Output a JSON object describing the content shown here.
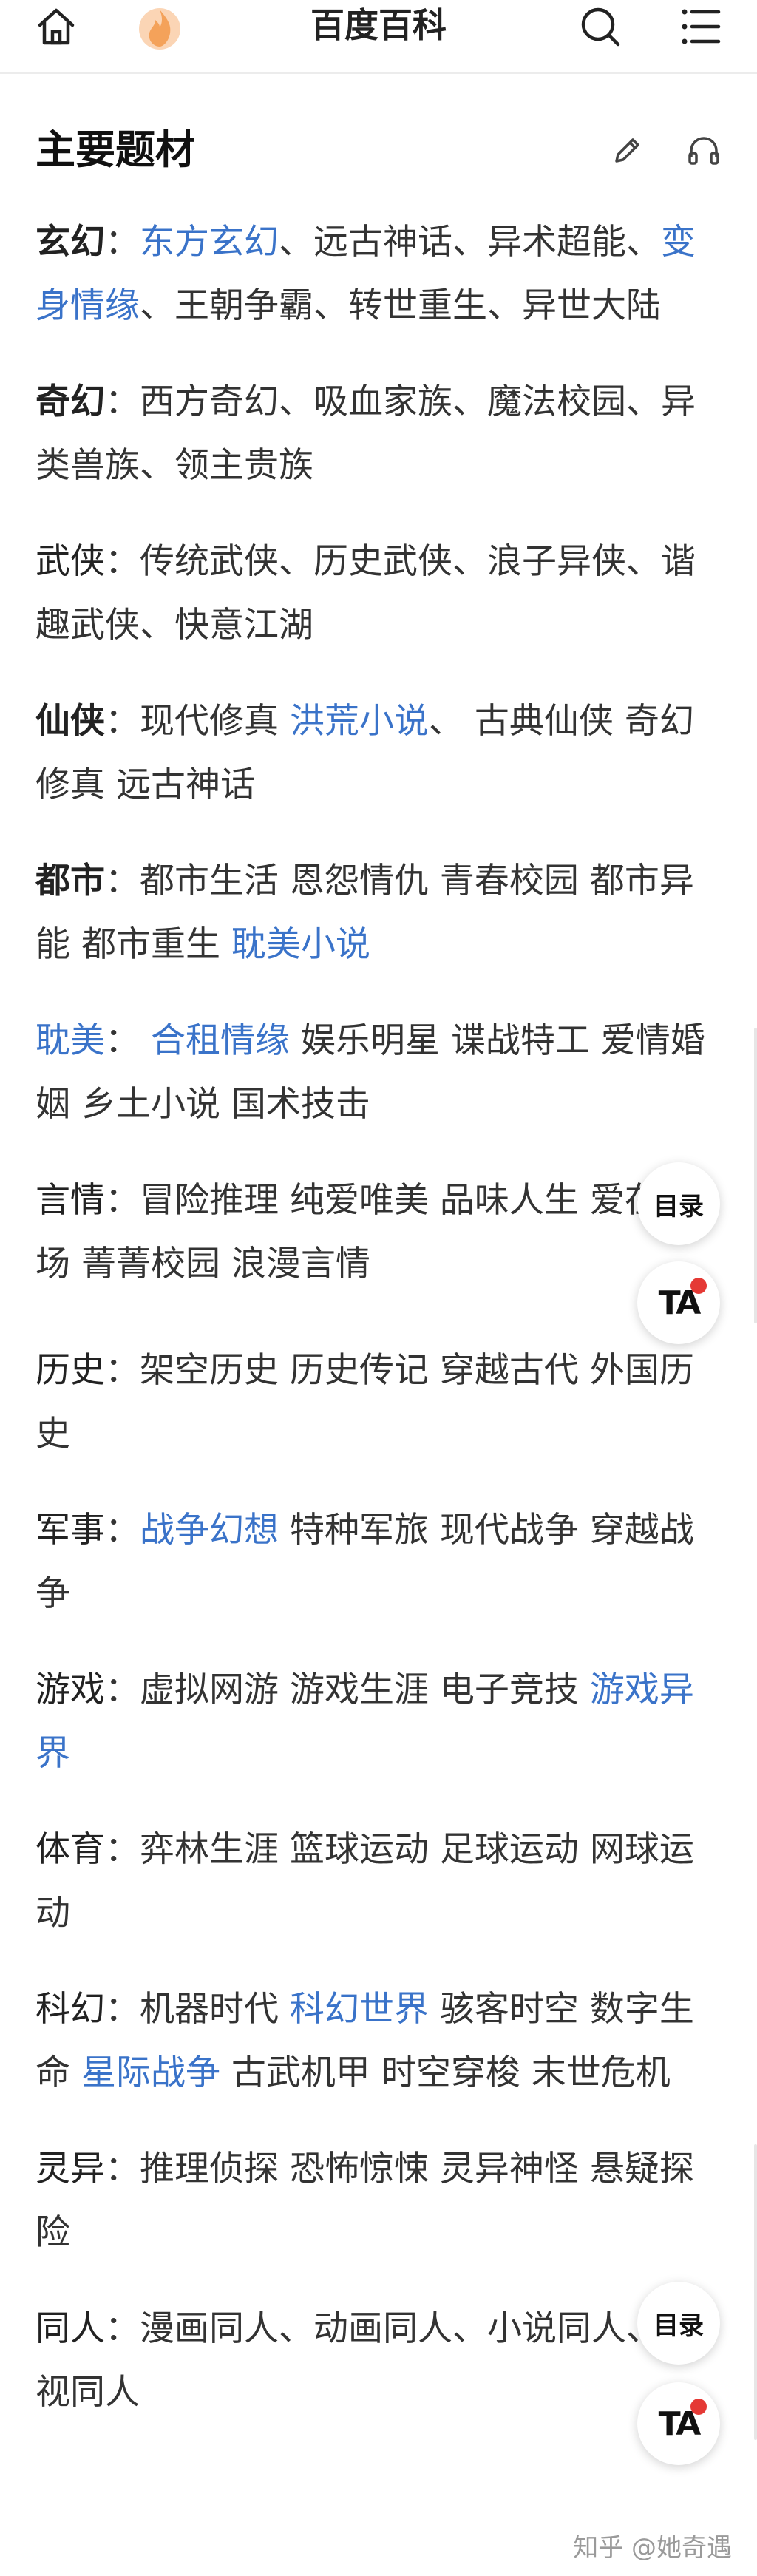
{
  "header": {
    "title": "百度百科",
    "icons": [
      "home-icon",
      "flame-icon",
      "search-icon",
      "menu-icon"
    ]
  },
  "section": {
    "title": "主要题材",
    "tools": [
      "edit-icon",
      "headphones-icon"
    ]
  },
  "entries": [
    {
      "label": "玄幻",
      "sep": "：",
      "style": "bold",
      "segments": [
        {
          "text": "东方玄幻",
          "link": true
        },
        {
          "text": "、远古神话、异术超能、",
          "link": false
        },
        {
          "text": "变身情缘",
          "link": true
        },
        {
          "text": "、王朝争霸、转世重生、异世大陆",
          "link": false
        }
      ]
    },
    {
      "label": "奇幻",
      "sep": "：",
      "style": "bold",
      "segments": [
        {
          "text": "西方奇幻、吸血家族、魔法校园、异类兽族、领主贵族",
          "link": false
        }
      ]
    },
    {
      "label": "武侠",
      "sep": "：",
      "style": "normal",
      "segments": [
        {
          "text": "传统武侠、历史武侠、浪子异侠、谐趣武侠、快意江湖",
          "link": false
        }
      ]
    },
    {
      "label": "仙侠",
      "sep": "：",
      "style": "bold",
      "segments": [
        {
          "text": "现代修真 ",
          "link": false
        },
        {
          "text": "洪荒小说",
          "link": true
        },
        {
          "text": "、 古典仙侠 奇幻修真 远古神话",
          "link": false
        }
      ]
    },
    {
      "label": "都市",
      "sep": "：",
      "style": "bold",
      "segments": [
        {
          "text": "都市生活 恩怨情仇 青春校园 都市异能 都市重生 ",
          "link": false
        },
        {
          "text": "耽美小说",
          "link": true
        }
      ]
    },
    {
      "label": "耽美",
      "sep": "：  ",
      "style": "link",
      "segments": [
        {
          "text": "合租情缘",
          "link": true
        },
        {
          "text": " 娱乐明星 谍战特工 爱情婚姻 乡土小说 国术技击",
          "link": false
        }
      ]
    },
    {
      "label": "言情",
      "sep": "：",
      "style": "normal",
      "segments": [
        {
          "text": "冒险推理 纯爱唯美 品味人生 爱在职场 菁菁校园 浪漫言情",
          "link": false
        }
      ]
    },
    {
      "label": "历史",
      "sep": "：",
      "style": "normal",
      "segments": [
        {
          "text": "架空历史 历史传记 穿越古代 外国历史",
          "link": false
        }
      ]
    },
    {
      "label": "军事",
      "sep": "：",
      "style": "normal",
      "segments": [
        {
          "text": "战争幻想",
          "link": true
        },
        {
          "text": " 特种军旅 现代战争 穿越战争",
          "link": false
        }
      ]
    },
    {
      "label": "游戏",
      "sep": "：",
      "style": "normal",
      "segments": [
        {
          "text": "虚拟网游 游戏生涯 电子竞技 ",
          "link": false
        },
        {
          "text": "游戏异界",
          "link": true
        }
      ]
    },
    {
      "label": "体育",
      "sep": "：",
      "style": "normal",
      "segments": [
        {
          "text": "弈林生涯 篮球运动 足球运动 网球运动",
          "link": false
        }
      ]
    },
    {
      "label": "科幻",
      "sep": "：",
      "style": "normal",
      "segments": [
        {
          "text": "机器时代 ",
          "link": false
        },
        {
          "text": "科幻世界",
          "link": true
        },
        {
          "text": " 骇客时空 数字生命 ",
          "link": false
        },
        {
          "text": "星际战争",
          "link": true
        },
        {
          "text": " 古武机甲 时空穿梭 末世危机",
          "link": false
        }
      ]
    },
    {
      "label": "灵异",
      "sep": "：",
      "style": "normal",
      "segments": [
        {
          "text": "推理侦探 恐怖惊悚 灵异神怪 悬疑探险",
          "link": false
        }
      ]
    },
    {
      "label": "同人",
      "sep": "：",
      "style": "normal",
      "segments": [
        {
          "text": "漫画同人、动画同人、小说同人、影视同人",
          "link": false
        }
      ]
    }
  ],
  "floating": {
    "toc_label": "目录",
    "ta_label": "TA"
  },
  "watermark": "知乎 @她奇遇",
  "colors": {
    "link": "#3a73c9",
    "accent_dot": "#e53935",
    "flame": "#f4a25a"
  }
}
